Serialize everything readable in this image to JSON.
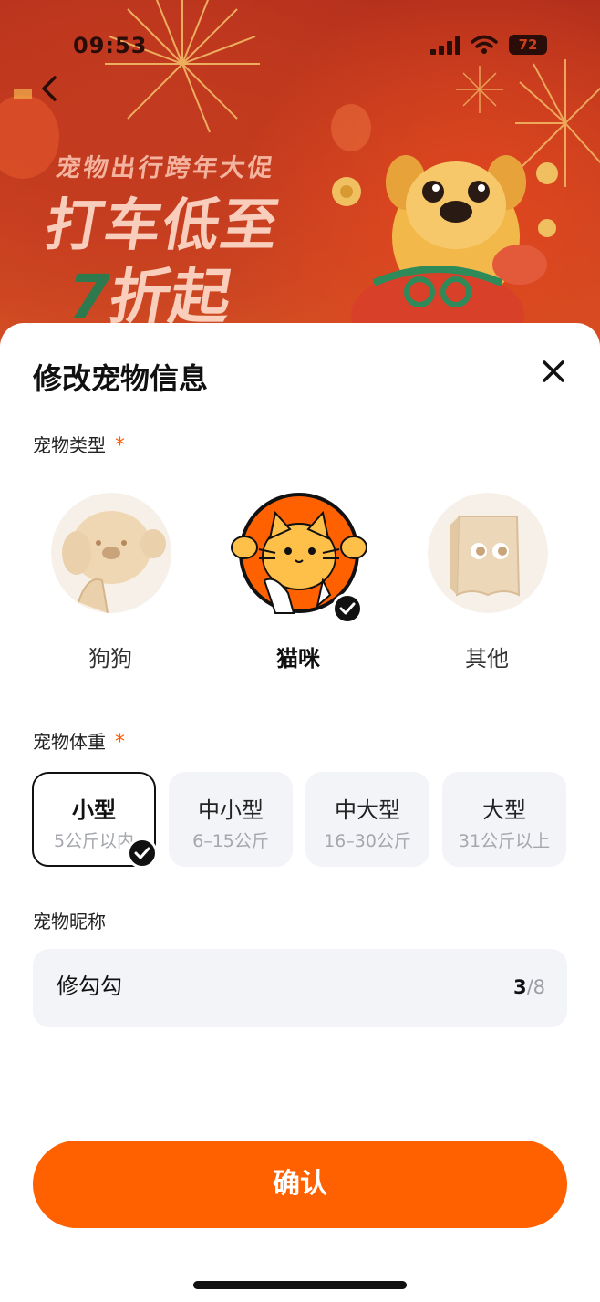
{
  "status_bar": {
    "time": "09:53",
    "battery": "72"
  },
  "banner": {
    "subtitle": "宠物出行跨年大促",
    "headline": "打车低至",
    "headline2_number": "7",
    "headline2_text": "折起"
  },
  "sheet": {
    "title": "修改宠物信息",
    "pet_type": {
      "label": "宠物类型",
      "required_mark": "*",
      "options": [
        {
          "label": "狗狗",
          "selected": false
        },
        {
          "label": "猫咪",
          "selected": true
        },
        {
          "label": "其他",
          "selected": false
        }
      ]
    },
    "pet_weight": {
      "label": "宠物体重",
      "required_mark": "*",
      "options": [
        {
          "name": "小型",
          "range": "5公斤以内",
          "selected": true
        },
        {
          "name": "中小型",
          "range": "6–15公斤",
          "selected": false
        },
        {
          "name": "中大型",
          "range": "16–30公斤",
          "selected": false
        },
        {
          "name": "大型",
          "range": "31公斤以上",
          "selected": false
        }
      ]
    },
    "nickname": {
      "label": "宠物昵称",
      "value": "修勾勾",
      "count": "3",
      "max": "/8"
    },
    "confirm_label": "确认"
  },
  "colors": {
    "accent": "#ff6000",
    "required": "#ff5a00",
    "field_bg": "#f3f4f8",
    "banner_red": "#c9401f"
  },
  "icons": [
    "back-arrow-icon",
    "signal-icon",
    "wifi-icon",
    "battery-icon",
    "close-icon",
    "check-icon"
  ]
}
